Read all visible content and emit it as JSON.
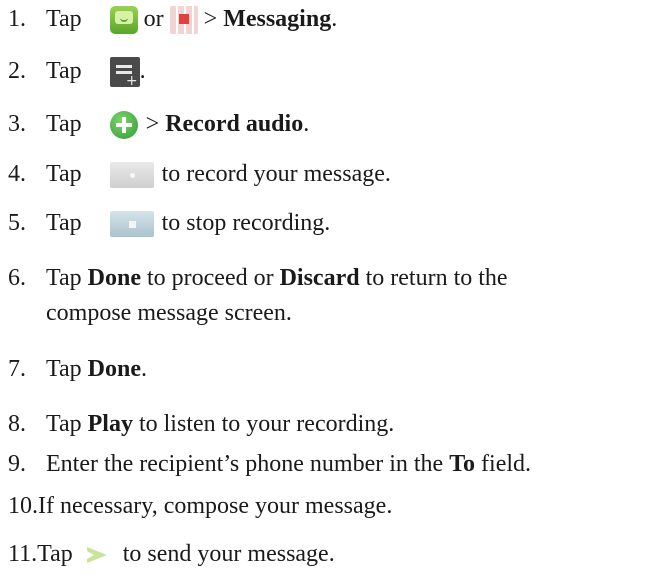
{
  "steps": [
    {
      "num": "1.",
      "parts": [
        "Tap",
        "or",
        ">",
        "Messaging",
        "."
      ]
    },
    {
      "num": "2.",
      "parts": [
        "Tap",
        "."
      ]
    },
    {
      "num": "3.",
      "parts": [
        "Tap",
        ">",
        "Record audio",
        "."
      ]
    },
    {
      "num": "4.",
      "parts": [
        "Tap",
        "to record your message."
      ]
    },
    {
      "num": "5.",
      "parts": [
        "Tap",
        "to stop recording."
      ]
    },
    {
      "num": "6.",
      "parts": [
        "Tap",
        "Done",
        "to proceed or",
        "Discard",
        "to return to the"
      ],
      "cont": "compose message screen."
    },
    {
      "num": "7.",
      "parts": [
        "Tap",
        "Done",
        "."
      ]
    },
    {
      "num": "8.",
      "parts": [
        "Tap",
        "Play",
        "to listen to your recording."
      ]
    },
    {
      "num": "9.",
      "parts": [
        "Enter the recipient’s phone number in the",
        "To",
        "field."
      ]
    },
    {
      "num": "10.",
      "parts": [
        "If necessary, compose your message."
      ]
    },
    {
      "num": "11.",
      "parts": [
        "Tap",
        "to send your message."
      ]
    }
  ],
  "icons": {
    "step1_a": "messaging-app-icon",
    "step1_b": "app-grid-icon",
    "step2": "compose-new-message-icon",
    "step3": "add-attachment-icon",
    "step4": "record-button-icon",
    "step5": "stop-button-icon",
    "step11": "send-arrow-icon"
  }
}
